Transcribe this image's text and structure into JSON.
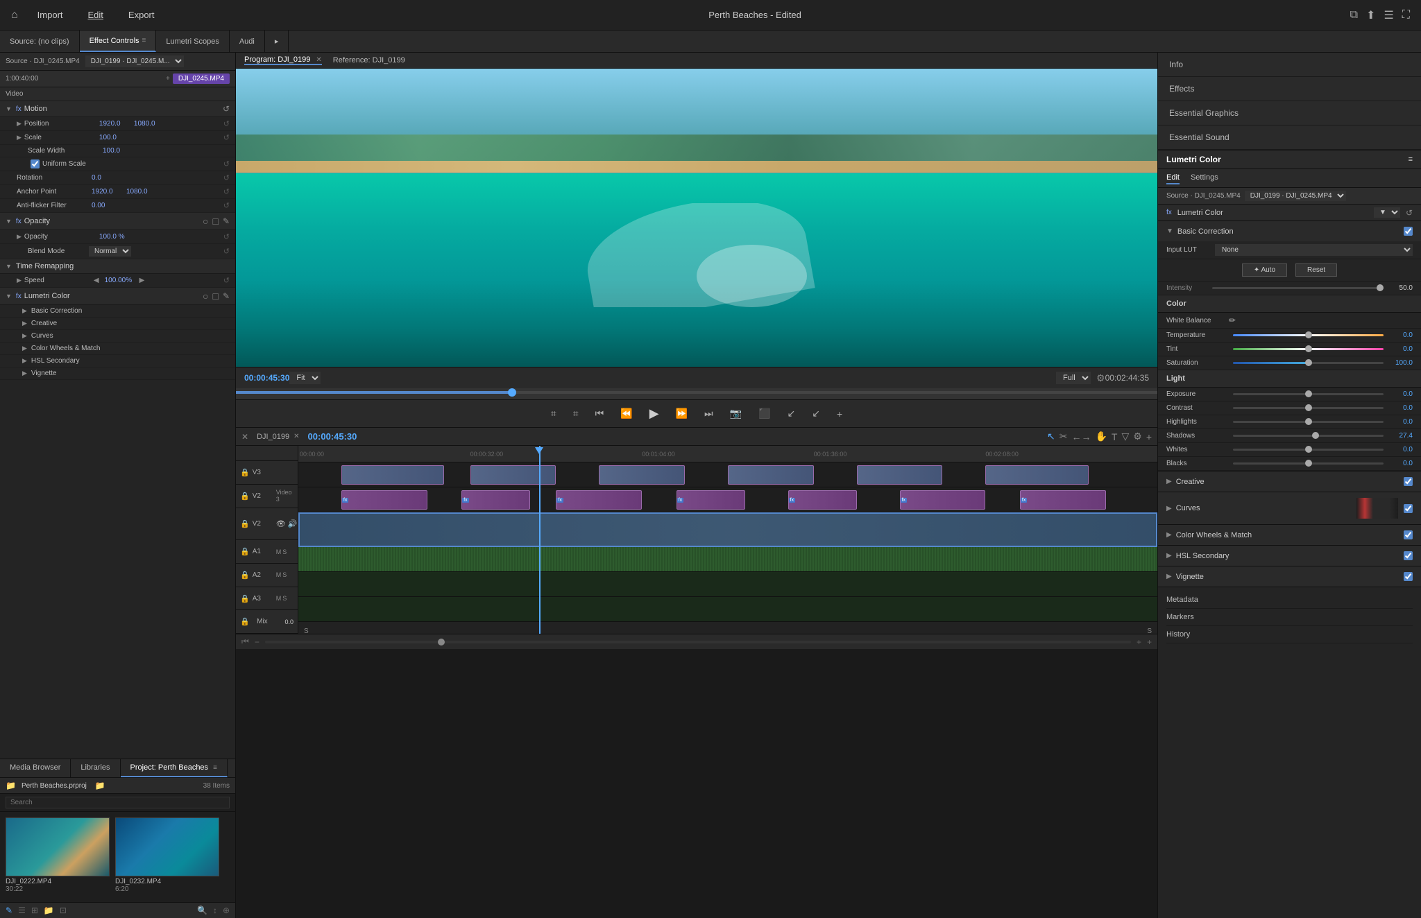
{
  "app": {
    "title": "Perth Beaches - Edited",
    "home_icon": "⌂",
    "nav": [
      "Import",
      "Edit",
      "Export"
    ],
    "active_nav": "Edit"
  },
  "panel_tabs": {
    "source": "Source: (no clips)",
    "effect_controls": "Effect Controls",
    "lumetri_scopes": "Lumetri Scopes",
    "audio": "Audi",
    "more": "▸"
  },
  "effect_controls": {
    "source_label": "Source · DJI_0245.MP4",
    "clip_label": "DJI_0199 · DJI_0245.M...",
    "time": "1:00:40:00",
    "clip_name": "DJI_0245.MP4",
    "video_label": "Video",
    "motion": {
      "label": "Motion",
      "position": {
        "label": "Position",
        "x": "1920.0",
        "y": "1080.0"
      },
      "scale": {
        "label": "Scale",
        "value": "100.0"
      },
      "scale_width": {
        "label": "Scale Width",
        "value": "100.0"
      },
      "uniform_scale": {
        "label": "Uniform Scale",
        "checked": true
      },
      "rotation": {
        "label": "Rotation",
        "value": "0.0"
      },
      "anchor_point": {
        "label": "Anchor Point",
        "x": "1920.0",
        "y": "1080.0"
      },
      "anti_flicker": {
        "label": "Anti-flicker Filter",
        "value": "0.00"
      }
    },
    "opacity": {
      "label": "Opacity",
      "value": "100.0 %",
      "blend_mode": "Normal"
    },
    "time_remapping": {
      "label": "Time Remapping",
      "speed": {
        "label": "Speed",
        "value": "100.00%"
      }
    },
    "lumetri_color": {
      "label": "Lumetri Color",
      "sections": [
        "Basic Correction",
        "Creative",
        "Curves",
        "Color Wheels & Match",
        "HSL Secondary",
        "Vignette"
      ]
    }
  },
  "program_monitor": {
    "program_tab": "Program: DJI_0199",
    "reference_tab": "Reference: DJI_0199",
    "timecode_left": "00:00:45:30",
    "timecode_right": "00:02:44:35",
    "fit": "Fit",
    "full": "Full"
  },
  "bottom_left": {
    "tabs": [
      "Media Browser",
      "Libraries",
      "Project: Perth Beaches"
    ],
    "active_tab": "Project: Perth Beaches",
    "project_name": "Perth Beaches.prproj",
    "item_count": "38 Items",
    "media_items": [
      {
        "name": "DJI_0222.MP4",
        "duration": "30:22",
        "thumb": "beach1"
      },
      {
        "name": "DJI_0232.MP4",
        "duration": "6:20",
        "thumb": "beach2"
      }
    ]
  },
  "timeline": {
    "clip_tab": "DJI_0199",
    "timecode": "00:00:45:30",
    "time_markers": [
      "00:00:00",
      "00:00:32:00",
      "00:01:04:00",
      "00:01:36:00",
      "00:02:08:00"
    ],
    "tracks": [
      {
        "id": "V3",
        "label": "V3",
        "type": "video"
      },
      {
        "id": "V2",
        "label": "V2",
        "type": "video"
      },
      {
        "id": "A1",
        "label": "A1",
        "type": "audio"
      },
      {
        "id": "A2",
        "label": "A2",
        "type": "audio"
      },
      {
        "id": "A3",
        "label": "A3",
        "type": "audio"
      }
    ],
    "mix_label": "Mix",
    "mix_value": "0.0"
  },
  "right_panel": {
    "info": "Info",
    "effects": "Effects",
    "essential_graphics": "Essential Graphics",
    "essential_sound": "Essential Sound",
    "lumetri_color": "Lumetri Color",
    "edit_tab": "Edit",
    "settings_tab": "Settings",
    "source": "Source · DJI_0245.MP4",
    "clip": "DJI_0199 · DJI_0245.MP4",
    "fx_label": "fx",
    "fx_name": "Lumetri Color",
    "basic_correction": {
      "title": "Basic Correction",
      "input_lut": {
        "label": "Input LUT",
        "value": "None"
      },
      "auto_btn": "✦ Auto",
      "reset_btn": "Reset",
      "intensity_label": "Intensity",
      "intensity_value": "50.0",
      "color_section": "Color",
      "white_balance": "White Balance",
      "temperature": {
        "label": "Temperature",
        "value": "0.0",
        "pct": 50
      },
      "tint": {
        "label": "Tint",
        "value": "0.0",
        "pct": 50
      },
      "saturation": {
        "label": "Saturation",
        "value": "100.0",
        "pct": 50
      },
      "light_section": "Light",
      "exposure": {
        "label": "Exposure",
        "value": "0.0",
        "pct": 50
      },
      "contrast": {
        "label": "Contrast",
        "value": "0.0",
        "pct": 50
      },
      "highlights": {
        "label": "Highlights",
        "value": "0.0",
        "pct": 50
      },
      "shadows": {
        "label": "Shadows",
        "value": "27.4",
        "pct": 55
      },
      "whites": {
        "label": "Whites",
        "value": "0.0",
        "pct": 50
      },
      "blacks": {
        "label": "Blacks",
        "value": "0.0",
        "pct": 50
      }
    },
    "sections": [
      {
        "id": "creative",
        "label": "Creative",
        "checked": true
      },
      {
        "id": "curves",
        "label": "Curves",
        "checked": true
      },
      {
        "id": "color_wheels",
        "label": "Color Wheels & Match",
        "checked": true
      },
      {
        "id": "hsl_secondary",
        "label": "HSL Secondary",
        "checked": true
      },
      {
        "id": "vignette",
        "label": "Vignette",
        "checked": true
      }
    ],
    "metadata": "Metadata",
    "markers": "Markers",
    "history": "History"
  }
}
